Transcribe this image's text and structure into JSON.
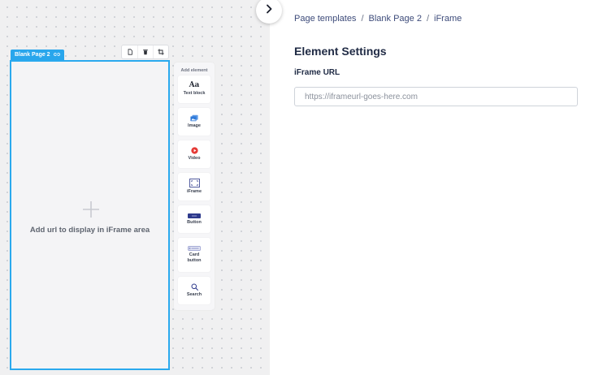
{
  "canvas": {
    "page_tag_label": "Blank Page 2",
    "frame_placeholder": "Add url to display in iFrame area"
  },
  "palette": {
    "title": "Add element",
    "items": [
      {
        "label": "Text block",
        "icon": "text-aa-icon",
        "glyph": "Aa"
      },
      {
        "label": "Image",
        "icon": "image-icon"
      },
      {
        "label": "Video",
        "icon": "video-play-icon"
      },
      {
        "label": "iFrame",
        "icon": "iframe-icon"
      },
      {
        "label": "Button",
        "icon": "button-icon"
      },
      {
        "label": "Card button",
        "icon": "card-button-icon"
      },
      {
        "label": "Search",
        "icon": "search-icon"
      }
    ]
  },
  "breadcrumb": [
    {
      "label": "Page templates"
    },
    {
      "label": "Blank Page 2"
    },
    {
      "label": "iFrame"
    }
  ],
  "breadcrumb_separator": "/",
  "settings": {
    "title": "Element Settings",
    "iframe_url_label": "iFrame URL",
    "iframe_url_value": "",
    "iframe_url_placeholder": "https://iframeurl-goes-here.com"
  },
  "colors": {
    "accent": "#29a6ec",
    "video_icon": "#e53935",
    "button_icon": "#2e3a8c",
    "breadcrumb_text": "#3d4b7a",
    "title_text": "#1f2a44"
  }
}
